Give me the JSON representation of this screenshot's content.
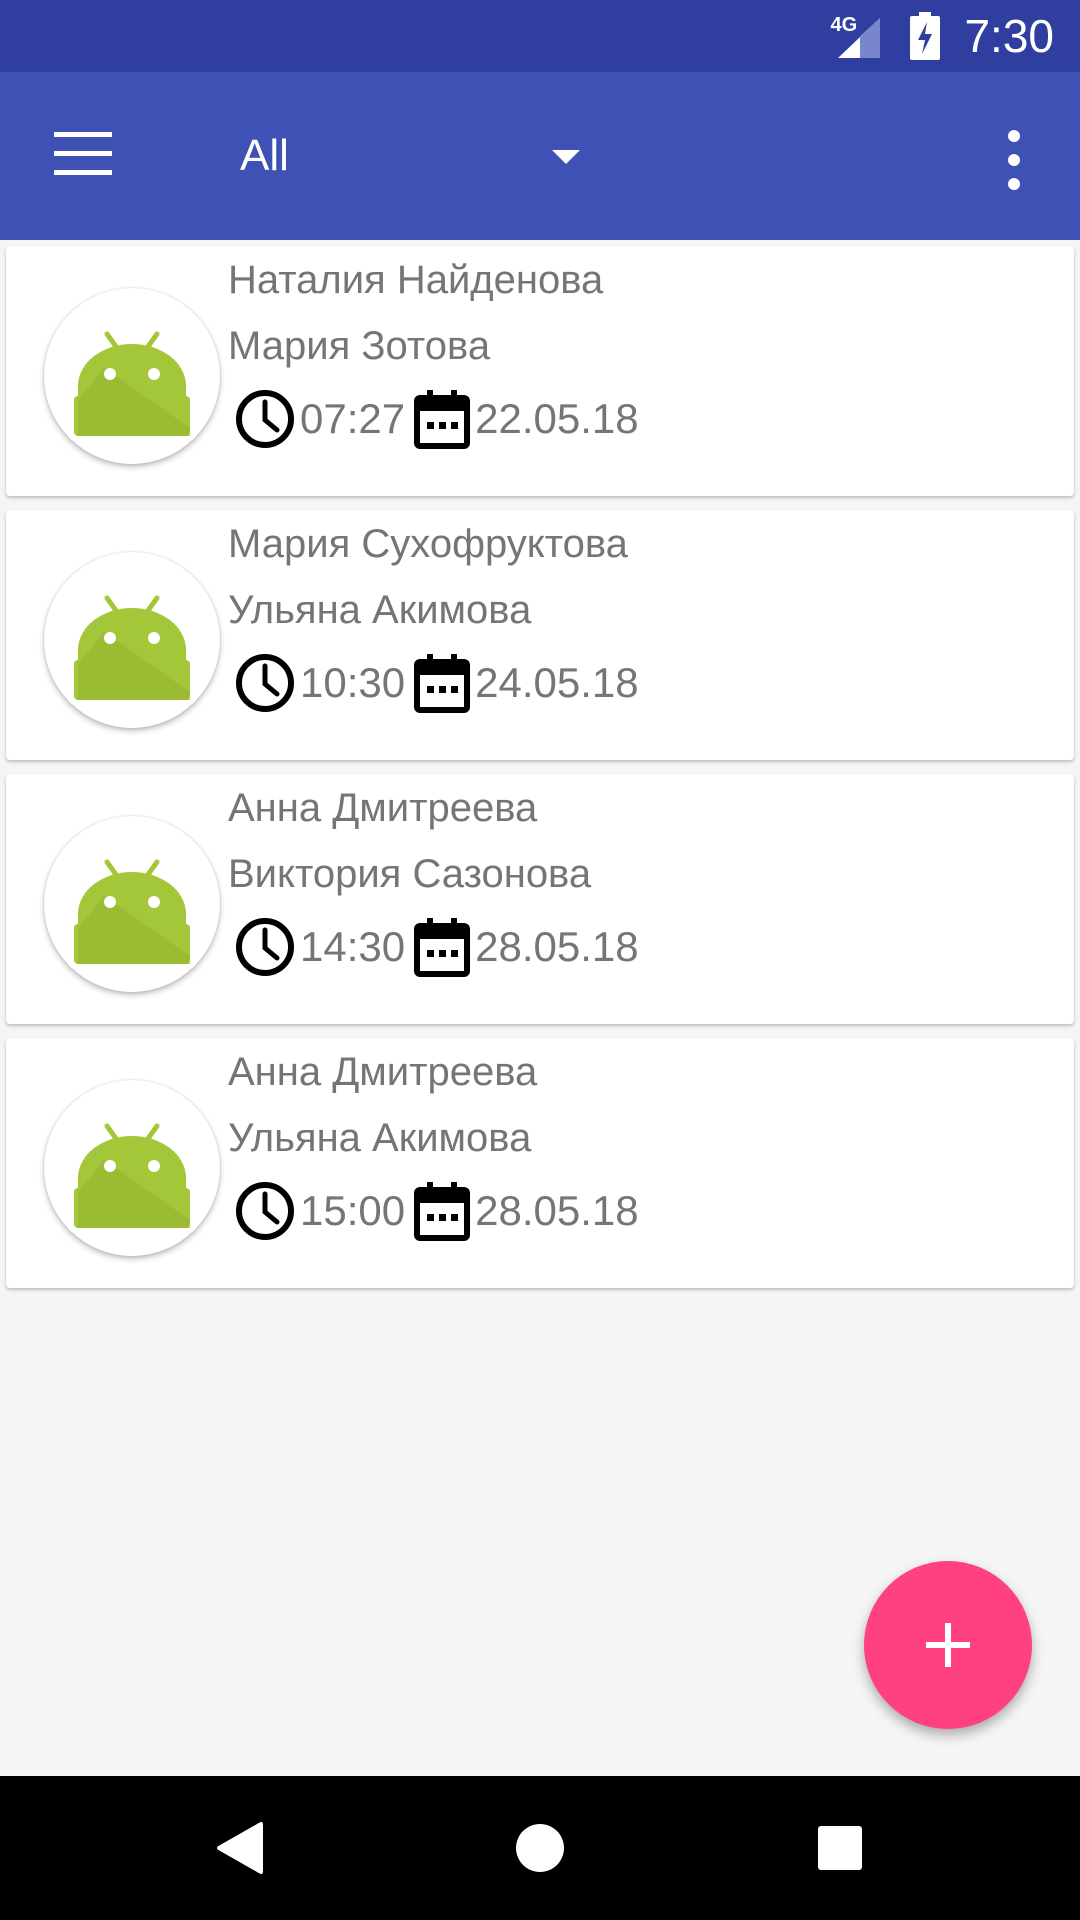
{
  "status_bar": {
    "network_label": "4G",
    "time": "7:30",
    "icons": [
      "signal-icon",
      "battery-charging-icon"
    ]
  },
  "toolbar": {
    "menu_icon": "hamburger-menu-icon",
    "filter_value": "All",
    "dropdown_icon": "dropdown-arrow-icon",
    "overflow_icon": "overflow-menu-icon",
    "color": "#3f51b5"
  },
  "cards": [
    {
      "line1": "Наталия Найденова",
      "line2": "Мария Зотова",
      "time": "07:27",
      "date": "22.05.18"
    },
    {
      "line1": "Мария Сухофруктова",
      "line2": "Ульяна Акимова",
      "time": "10:30",
      "date": "24.05.18"
    },
    {
      "line1": "Анна Дмитреева",
      "line2": "Виктория Сазонова",
      "time": "14:30",
      "date": "28.05.18"
    },
    {
      "line1": "Анна Дмитреева",
      "line2": "Ульяна Акимова",
      "time": "15:00",
      "date": "28.05.18"
    }
  ],
  "fab": {
    "icon": "plus-icon",
    "color": "#ff4081"
  },
  "nav_bar": {
    "icons": [
      "back-icon",
      "home-icon",
      "recents-icon"
    ]
  }
}
